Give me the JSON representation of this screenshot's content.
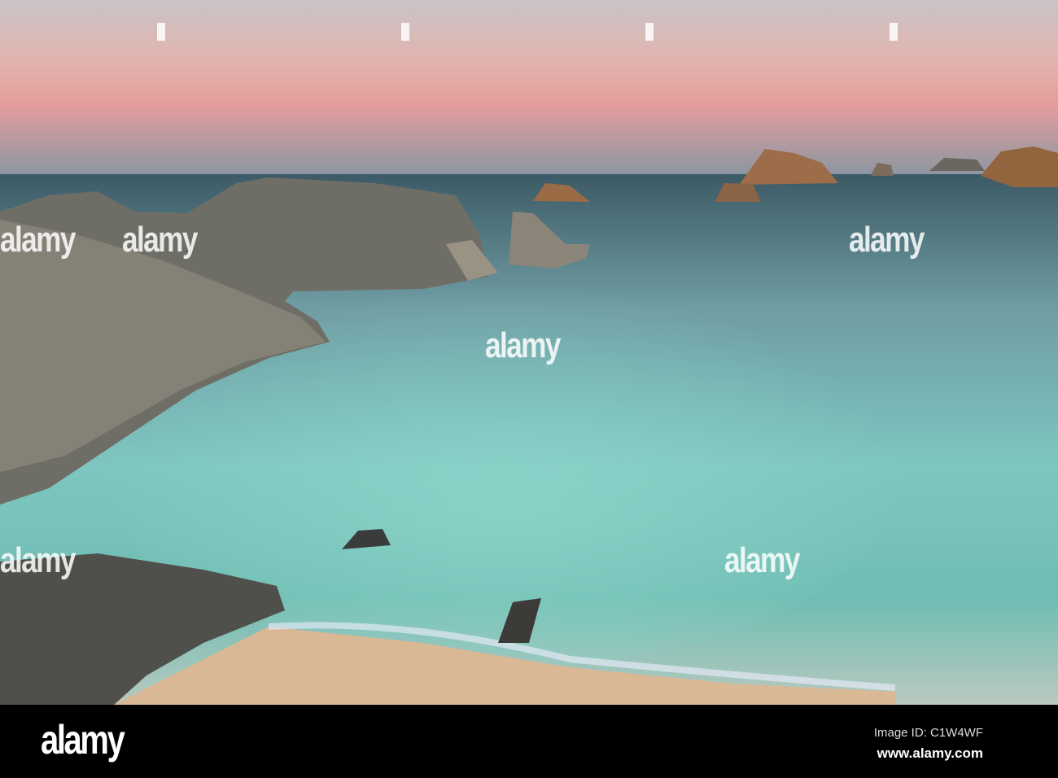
{
  "watermark": {
    "text": "alamy"
  },
  "footer": {
    "logo": "alamy",
    "image_id": "Image ID: C1W4WF",
    "url": "www.alamy.com"
  }
}
